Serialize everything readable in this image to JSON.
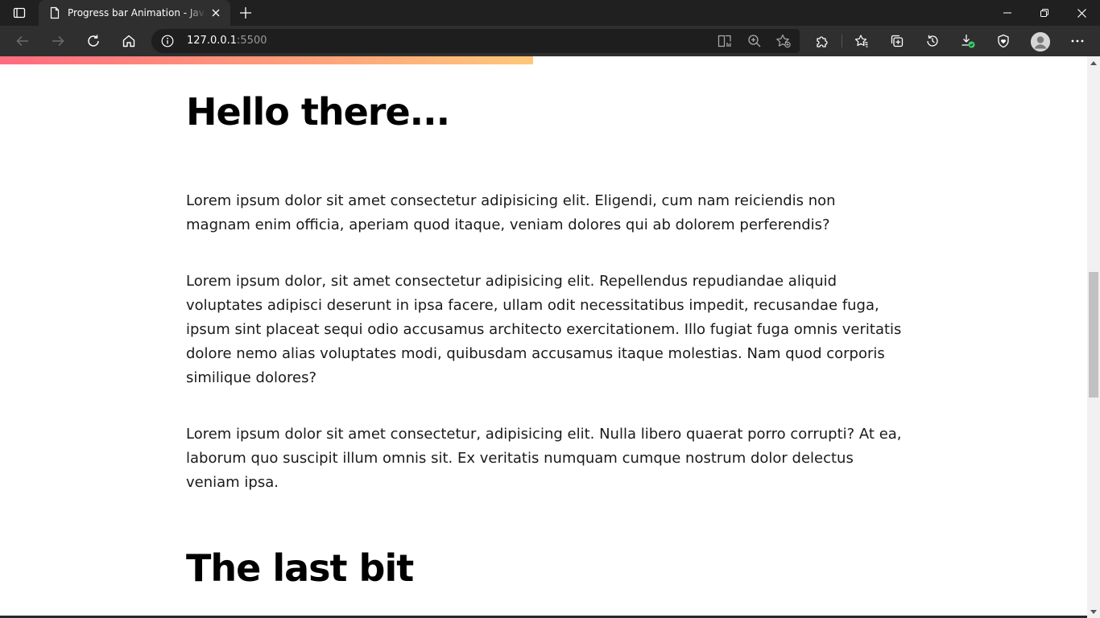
{
  "browser": {
    "tab": {
      "title": "Progress bar Animation - Javascript",
      "icon": "page-icon"
    },
    "address": {
      "host": "127.0.0.1",
      "port": ":5500"
    },
    "icons": {
      "tab_actions": "tab-actions-icon",
      "new_tab": "plus-icon",
      "minimize": "minimize-icon",
      "restore": "restore-icon",
      "close": "close-icon",
      "back": "back-arrow-icon",
      "forward": "forward-arrow-icon",
      "refresh": "refresh-icon",
      "home": "home-icon",
      "site_info": "info-icon",
      "immersive_reader": "immersive-reader-icon",
      "zoom": "zoom-icon",
      "add_favorite": "add-favorite-icon",
      "extensions": "puzzle-icon",
      "favorites": "favorites-icon",
      "collections": "collections-icon",
      "history": "history-icon",
      "downloads": "download-icon",
      "browser_essentials": "heart-shield-icon",
      "profile": "profile-icon",
      "menu": "more-icon"
    }
  },
  "page": {
    "progress_fraction": 0.49,
    "heading1": "Hello there...",
    "paragraphs": [
      "Lorem ipsum dolor sit amet consectetur adipisicing elit. Eligendi, cum nam reiciendis non magnam enim officia, aperiam quod itaque, veniam dolores qui ab dolorem perferendis?",
      "Lorem ipsum dolor, sit amet consectetur adipisicing elit. Repellendus repudiandae aliquid voluptates adipisci deserunt in ipsa facere, ullam odit necessitatibus impedit, recusandae fuga, ipsum sint placeat sequi odio accusamus architecto exercitationem. Illo fugiat fuga omnis veritatis dolore nemo alias voluptates modi, quibusdam accusamus itaque molestias. Nam quod corporis similique dolores?",
      "Lorem ipsum dolor sit amet consectetur, adipisicing elit. Nulla libero quaerat porro corrupti? At ea, laborum quo suscipit illum omnis sit. Ex veritatis numquam cumque nostrum dolor delectus veniam ipsa."
    ],
    "heading2": "The last bit"
  },
  "colors": {
    "progress_start": "#ff6b7f",
    "progress_end": "#ffc77a",
    "chrome_dark": "#202020",
    "toolbar": "#2f2f2f"
  }
}
